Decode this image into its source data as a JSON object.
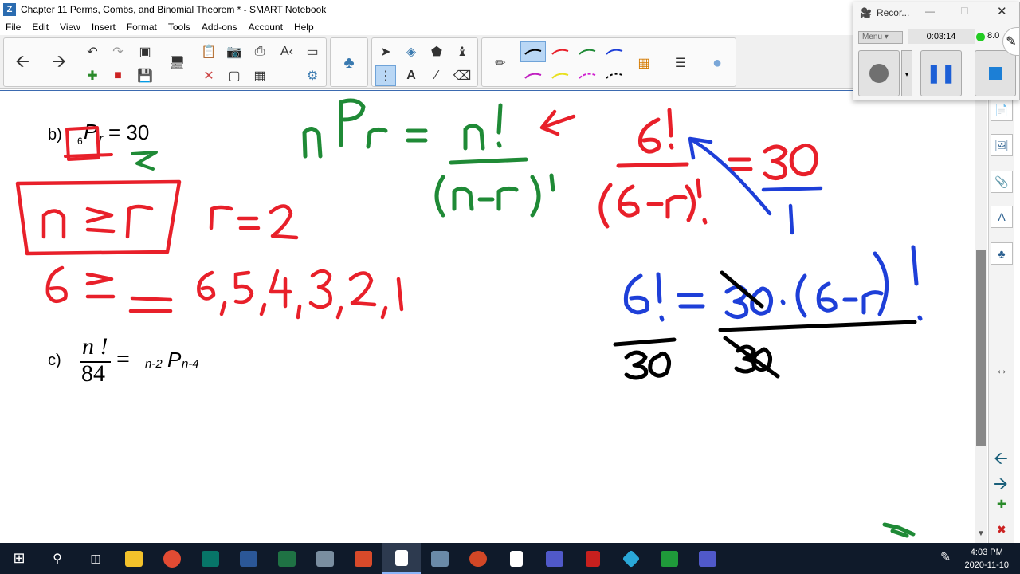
{
  "window": {
    "title": "Chapter 11 Perms, Combs, and Binomial Theorem * - SMART Notebook"
  },
  "menu": [
    "File",
    "Edit",
    "View",
    "Insert",
    "Format",
    "Tools",
    "Add-ons",
    "Account",
    "Help"
  ],
  "recorder": {
    "title": "Recor...",
    "menu_label": "Menu",
    "time": "0:03:14",
    "level": "8.0"
  },
  "content": {
    "b_label": "b)",
    "b_prefix": "6",
    "b_P": "P",
    "b_r": "r",
    "b_eq": "= 30",
    "c_label": "c)",
    "c_num": "n !",
    "c_den": "84",
    "c_eq": "=",
    "c_pre": "n-2",
    "c_P": "P",
    "c_sub": "n-4"
  },
  "ink": {
    "red_color": "#e8202a",
    "green_color": "#1f8a36",
    "blue_color": "#1e3fd8",
    "black_color": "#000000"
  },
  "taskbar": {
    "time": "4:03 PM",
    "date": "2020-11-10"
  }
}
